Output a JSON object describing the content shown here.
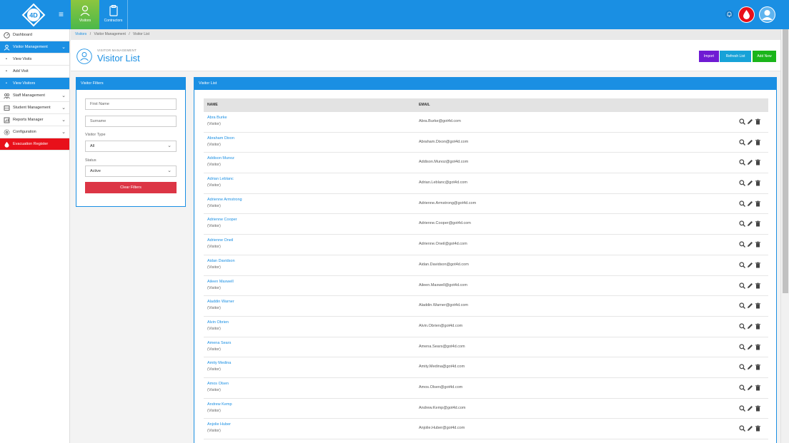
{
  "colors": {
    "primary": "#1a8fe3",
    "active_tab": "#8cc63f",
    "danger": "#dc3545",
    "evac": "#e8101a",
    "import": "#6f1bd3",
    "refresh": "#17a2d8",
    "add_new": "#1ab51a"
  },
  "topnav": {
    "tabs": [
      {
        "label": "Visitors",
        "icon": "visitor-icon",
        "active": true
      },
      {
        "label": "Contractors",
        "icon": "clipboard-icon",
        "active": false
      }
    ],
    "right_icons": [
      "bell-icon",
      "evacuation-drop-icon",
      "user-avatar-icon"
    ]
  },
  "sidebar": {
    "items": [
      {
        "label": "Dashboard",
        "icon": "dashboard-icon"
      },
      {
        "label": "Visitor Management",
        "icon": "visitor-icon"
      },
      {
        "label": "View Visits"
      },
      {
        "label": "Add Visit"
      },
      {
        "label": "View Visitors"
      },
      {
        "label": "Staff Management",
        "icon": "staff-icon"
      },
      {
        "label": "Student Management",
        "icon": "student-icon"
      },
      {
        "label": "Reports Manager",
        "icon": "reports-icon"
      },
      {
        "label": "Configuration",
        "icon": "gear-icon"
      },
      {
        "label": "Evacuation Register",
        "icon": "drop-icon"
      }
    ]
  },
  "breadcrumb": {
    "items": [
      "Visitors",
      "Visitor Management",
      "Visitor List"
    ],
    "sep": "/"
  },
  "header": {
    "subtitle": "VISITOR MANAGEMENT",
    "title": "Visitor List"
  },
  "buttons": {
    "import": "Import",
    "refresh": "Refresh List",
    "add_new": "Add New"
  },
  "filters": {
    "title": "Visitor Filters",
    "first_name_placeholder": "First Name",
    "surname_placeholder": "Surname",
    "visitor_type_label": "Visitor Type",
    "visitor_type_value": "All",
    "status_label": "Status",
    "status_value": "Active",
    "clear_label": "Clear Filters"
  },
  "list": {
    "title": "Visitor List",
    "columns": [
      "NAME",
      "EMAIL"
    ],
    "rows": [
      {
        "name": "Abra Burke",
        "type": "(Visitor)",
        "email": "Abra.Burke@got4d.com"
      },
      {
        "name": "Abraham Dixon",
        "type": "(Visitor)",
        "email": "Abraham.Dixon@got4d.com"
      },
      {
        "name": "Addison Munoz",
        "type": "(Visitor)",
        "email": "Addison.Munoz@got4d.com"
      },
      {
        "name": "Adrian Leblanc",
        "type": "(Visitor)",
        "email": "Adrian.Leblanc@got4d.com"
      },
      {
        "name": "Adrienne Armstrong",
        "type": "(Visitor)",
        "email": "Adrienne.Armstrong@got4d.com"
      },
      {
        "name": "Adrienne Cooper",
        "type": "(Visitor)",
        "email": "Adrienne.Cooper@got4d.com"
      },
      {
        "name": "Adrienne Oneil",
        "type": "(Visitor)",
        "email": "Adrienne.Oneil@got4d.com"
      },
      {
        "name": "Aidan Davidson",
        "type": "(Visitor)",
        "email": "Aidan.Davidson@got4d.com"
      },
      {
        "name": "Aileen Maxwell",
        "type": "(Visitor)",
        "email": "Aileen.Maxwell@got4d.com"
      },
      {
        "name": "Aladdin Warner",
        "type": "(Visitor)",
        "email": "Aladdin.Warner@got4d.com"
      },
      {
        "name": "Alvin Obrien",
        "type": "(Visitor)",
        "email": "Alvin.Obrien@got4d.com"
      },
      {
        "name": "Amena Sears",
        "type": "(Visitor)",
        "email": "Amena.Sears@got4d.com"
      },
      {
        "name": "Amity Medina",
        "type": "(Visitor)",
        "email": "Amity.Medina@got4d.com"
      },
      {
        "name": "Amos Olsen",
        "type": "(Visitor)",
        "email": "Amos.Olsen@got4d.com"
      },
      {
        "name": "Andrew Kemp",
        "type": "(Visitor)",
        "email": "Andrew.Kemp@got4d.com"
      },
      {
        "name": "Anjolie Huber",
        "type": "(Visitor)",
        "email": "Anjolie.Huber@got4d.com"
      }
    ],
    "row_actions": [
      "search-icon",
      "edit-pencil-icon",
      "trash-icon"
    ]
  }
}
